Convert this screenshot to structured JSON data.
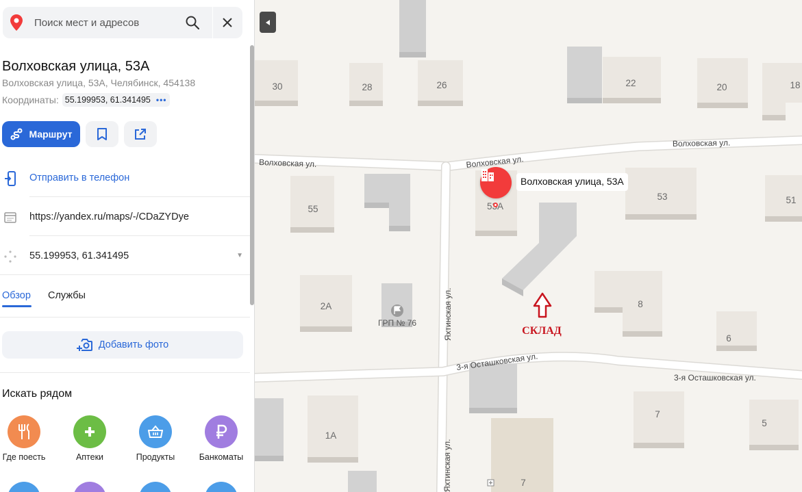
{
  "search": {
    "placeholder": "Поиск мест и адресов"
  },
  "place": {
    "title": "Волховская улица, 53А",
    "address": "Волховская улица, 53А, Челябинск, 454138",
    "coords_label": "Координаты:",
    "coords_value": "55.199953, 61.341495"
  },
  "actions": {
    "route_label": "Маршрут",
    "bookmark_icon": "bookmark-icon",
    "share_icon": "share-icon"
  },
  "rows": {
    "send_phone": "Отправить в телефон",
    "link": "https://yandex.ru/maps/-/CDaZYDye",
    "coords": "55.199953, 61.341495"
  },
  "tabs": [
    {
      "label": "Обзор",
      "active": true
    },
    {
      "label": "Службы",
      "active": false
    }
  ],
  "add_photo_label": "Добавить фото",
  "nearby": {
    "title": "Искать рядом",
    "categories": [
      {
        "label": "Где поесть",
        "icon": "fork-knife-icon",
        "color": "#f28b50"
      },
      {
        "label": "Аптеки",
        "icon": "plus-icon",
        "color": "#6cbd45"
      },
      {
        "label": "Продукты",
        "icon": "basket-icon",
        "color": "#4c9de8"
      },
      {
        "label": "Банкоматы",
        "icon": "ruble-icon",
        "color": "#a07de0"
      }
    ]
  },
  "map": {
    "streets": {
      "volkhovskaya_left": "Волховская ул.",
      "volkhovskaya_mid": "Волховская ул.",
      "volkhovskaya_right": "Волховская ул.",
      "yakhtinskaya": "Яхтинская ул.",
      "yakhtinskaya_2": "Яхтинская ул.",
      "ostashkovskaya_left": "3-я Осташковская ул.",
      "ostashkovskaya_right": "3-я Осташковская ул."
    },
    "house_numbers": {
      "h30": "30",
      "h28": "28",
      "h26": "26",
      "h22": "22",
      "h20": "20",
      "h18": "18",
      "h55": "55",
      "h53a": "53А",
      "h53": "53",
      "h51": "51",
      "h2a": "2А",
      "h8": "8",
      "h6": "6",
      "h1a": "1А",
      "h7a": "7",
      "h7b": "7",
      "h5": "5"
    },
    "poi_grp": "ГРП № 76",
    "marker_label": "Волховская улица, 53А",
    "annotation": "СКЛАД",
    "annotation_color": "#c8141e",
    "marker_color": "#f23b3b"
  },
  "colors": {
    "accent": "#2a68d8"
  }
}
